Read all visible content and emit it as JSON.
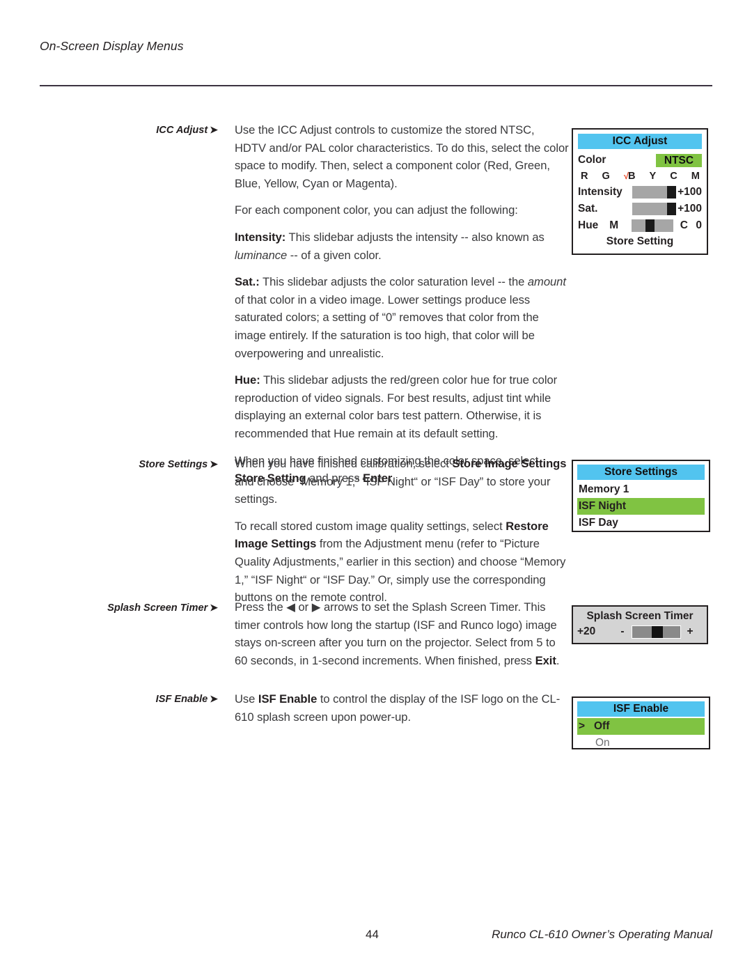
{
  "header": {
    "title": "On-Screen Display Menus"
  },
  "sections": [
    {
      "label": "ICC Adjust",
      "arrow": "➤",
      "paragraphs": [
        "Use the ICC Adjust controls to customize the stored NTSC, HDTV and/or PAL color characteristics. To do this, select the color space to modify. Then, select a component color (Red, Green, Blue, Yellow, Cyan or Magenta).",
        "For each component color, you can adjust the following:",
        "Intensity: This slidebar adjusts the intensity -- also known as luminance -- of a given color.",
        "Sat.: This slidebar adjusts the color saturation level -- the amount of that color in a video image. Lower settings produce less saturated colors; a setting of “0” removes that color from the image entirely. If the saturation is too high, that color will be overpowering and unrealistic.",
        "Hue: This slidebar adjusts the red/green color hue for true color reproduction of video signals. For best results, adjust tint while displaying an external color bars test pattern. Otherwise, it is recommended that Hue remain at its default setting.",
        "When you have finished customizing the color space, select Store Setting and press Enter."
      ]
    },
    {
      "label": "Store Settings",
      "arrow": "➤",
      "paragraphs": [
        "When you have finished calibration, select Store Image Settings and choose “Memory 1,” “ISF Night“ or “ISF Day” to store your settings.",
        "To recall stored custom image quality settings, select Restore Image Settings from the Adjustment menu (refer to “Picture Quality Adjustments,” earlier in this section) and choose “Memory 1,” “ISF Night“ or “ISF Day.” Or, simply use the corresponding buttons on the remote control."
      ]
    },
    {
      "label": "Splash Screen Timer",
      "arrow": "➤",
      "paragraphs": [
        "Press the ◀ or ▶ arrows to set the Splash Screen Timer. This timer controls how long the startup (ISF and Runco logo) image stays on-screen after you turn on the projector. Select from 5 to 60 seconds, in 1-second increments. When finished, press Exit."
      ]
    },
    {
      "label": "ISF Enable",
      "arrow": "➤",
      "paragraphs": [
        "Use ISF Enable to control the display of the ISF logo on the CL-610 splash screen upon power-up."
      ]
    }
  ],
  "osd": {
    "icc": {
      "title": "ICC Adjust",
      "color_label": "Color",
      "color_value": "NTSC",
      "components": [
        "R",
        "G",
        "B",
        "Y",
        "C",
        "M"
      ],
      "selected_component": "B",
      "check_glyph": "√",
      "intensity_label": "Intensity",
      "intensity_value": "+100",
      "sat_label": "Sat.",
      "sat_value": "+100",
      "hue_label": "Hue",
      "hue_left": "M",
      "hue_right": "C",
      "hue_value": "0",
      "store_setting": "Store Setting"
    },
    "store": {
      "title": "Store Settings",
      "options": [
        "Memory 1",
        "ISF Night",
        "ISF Day"
      ],
      "selected": "ISF Night"
    },
    "splash": {
      "title": "Splash Screen Timer",
      "value": "+20",
      "minus": "-",
      "plus": "+"
    },
    "isf": {
      "title": "ISF Enable",
      "caret": ">",
      "options": [
        "Off",
        "On"
      ],
      "selected": "Off"
    }
  },
  "footer": {
    "page_number": "44",
    "manual_text": "Runco CL-610 Owner’s Operating Manual"
  },
  "colors": {
    "osd_title_bg": "#52c4ef",
    "osd_highlight_green": "#80c342",
    "check_red": "#e8401c",
    "slider_track": "#a6a6a6",
    "slider_thumb": "#1a1a1a",
    "rule": "#3b3340"
  }
}
